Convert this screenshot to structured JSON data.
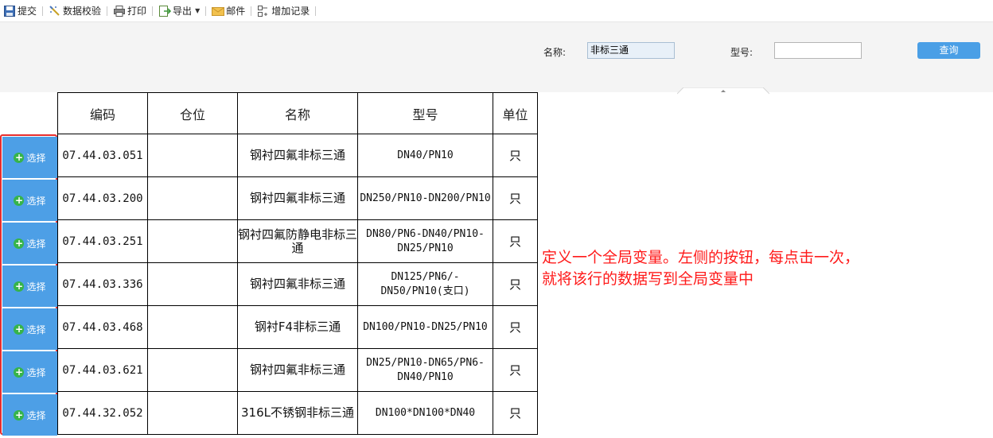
{
  "toolbar": {
    "items": [
      {
        "label": "提交",
        "icon": "save-icon"
      },
      {
        "label": "数据校验",
        "icon": "wand-icon"
      },
      {
        "label": "打印",
        "icon": "printer-icon"
      },
      {
        "label": "导出",
        "icon": "export-icon",
        "dropdown": true
      },
      {
        "label": "邮件",
        "icon": "mail-icon"
      },
      {
        "label": "增加记录",
        "icon": "add-record-icon"
      }
    ]
  },
  "filter": {
    "name_label": "名称:",
    "name_value": "非标三通",
    "model_label": "型号:",
    "model_value": "",
    "query_label": "查询"
  },
  "table": {
    "headers": [
      "编码",
      "仓位",
      "名称",
      "型号",
      "单位"
    ],
    "rows": [
      {
        "code": "07.44.03.051",
        "location": "",
        "name": "钢衬四氟非标三通",
        "model": "DN40/PN10",
        "unit": "只"
      },
      {
        "code": "07.44.03.200",
        "location": "",
        "name": "钢衬四氟非标三通",
        "model": "DN250/PN10-DN200/PN10",
        "unit": "只"
      },
      {
        "code": "07.44.03.251",
        "location": "",
        "name": "钢衬四氟防静电非标三通",
        "model": "DN80/PN6-DN40/PN10-DN25/PN10",
        "unit": "只"
      },
      {
        "code": "07.44.03.336",
        "location": "",
        "name": "钢衬四氟非标三通",
        "model": "DN125/PN6/-DN50/PN10(支口)",
        "unit": "只"
      },
      {
        "code": "07.44.03.468",
        "location": "",
        "name": "钢衬F4非标三通",
        "model": "DN100/PN10-DN25/PN10",
        "unit": "只"
      },
      {
        "code": "07.44.03.621",
        "location": "",
        "name": "钢衬四氟非标三通",
        "model": "DN25/PN10-DN65/PN6-DN40/PN10",
        "unit": "只"
      },
      {
        "code": "07.44.32.052",
        "location": "",
        "name": "316L不锈钢非标三通",
        "model": "DN100*DN100*DN40",
        "unit": "只"
      }
    ]
  },
  "select_button_label": "选择",
  "annotation": {
    "line1": "定义一个全局变量。左侧的按钮，每点击一次，",
    "line2": "就将该行的数据写到全局变量中"
  },
  "colors": {
    "accent": "#4d9fe6",
    "highlight_border": "#e62e2e",
    "annotation": "#ff1a1a",
    "plus": "#36b44a"
  }
}
